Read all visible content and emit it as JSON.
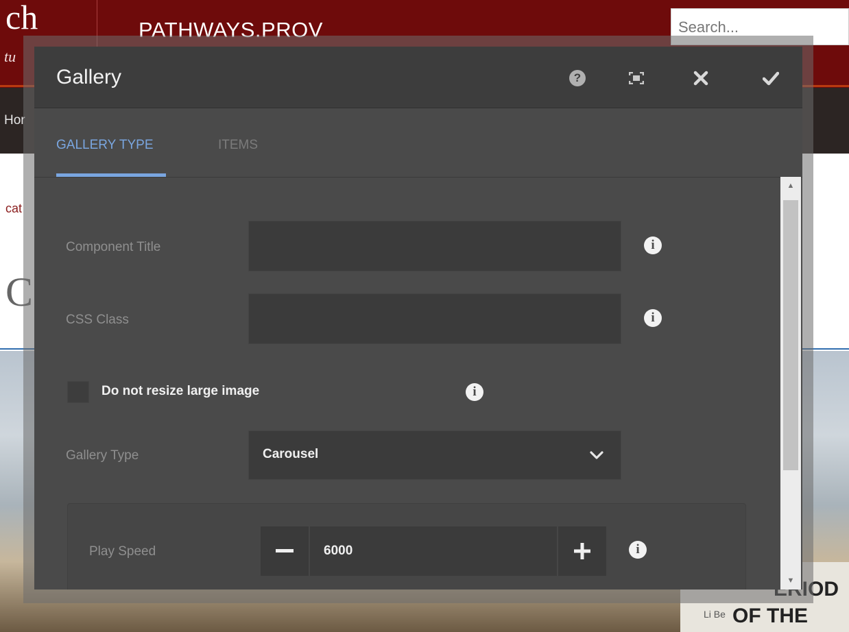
{
  "background": {
    "logo_text": "ch",
    "logo_sub": "tu",
    "site_title": "PATHWAYS.PROV",
    "search_placeholder": "Search...",
    "nav_item": "Hor",
    "breadcrumb": "cat",
    "heading": "C",
    "image_caption_1": "ERIOD",
    "image_caption_2": "OF THE",
    "image_symbols": "Li Be"
  },
  "dialog": {
    "title": "Gallery",
    "header_buttons": {
      "help_icon": "help-icon",
      "fullscreen_icon": "fullscreen-icon",
      "close_icon": "close-icon",
      "done_icon": "checkmark-icon"
    },
    "tabs": [
      {
        "label": "GALLERY TYPE",
        "active": true
      },
      {
        "label": "ITEMS",
        "active": false
      }
    ],
    "fields": {
      "component_title": {
        "label": "Component Title",
        "value": ""
      },
      "css_class": {
        "label": "CSS Class",
        "value": ""
      },
      "resize_checkbox": {
        "label": "Do not resize large image",
        "checked": false
      },
      "gallery_type": {
        "label": "Gallery Type",
        "value": "Carousel"
      },
      "play_speed": {
        "label": "Play Speed",
        "value": "6000"
      }
    }
  },
  "colors": {
    "header_red": "#6e0b0b",
    "dialog_bg": "#4a4a4a",
    "dialog_header_bg": "#3d3d3d",
    "accent_blue": "#7aa6e0"
  }
}
